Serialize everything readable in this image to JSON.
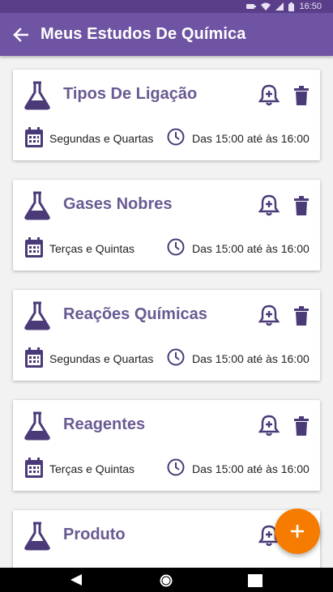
{
  "status_bar": {
    "time": "16:50"
  },
  "app_bar": {
    "title": "Meus Estudos De Química"
  },
  "cards": [
    {
      "title": "Tipos De Ligação",
      "days": "Segundas e Quartas",
      "hours": "Das 15:00 até às 16:00"
    },
    {
      "title": "Gases Nobres",
      "days": "Terças e Quintas",
      "hours": "Das 15:00 até às 16:00"
    },
    {
      "title": "Reações Químicas",
      "days": "Segundas e Quartas",
      "hours": "Das 15:00 até às 16:00"
    },
    {
      "title": "Reagentes",
      "days": "Terças e Quintas",
      "hours": "Das 15:00 até às 16:00"
    },
    {
      "title": "Produto",
      "days": "",
      "hours": ""
    }
  ],
  "colors": {
    "primary": "#6e54a3",
    "status": "#5a3e8a",
    "accent": "#f57c00",
    "icon": "#4a3a78",
    "title_text": "#6a5a93"
  },
  "icons": {
    "back": "arrow-left-icon",
    "flask": "flask-icon",
    "alarm": "alarm-add-icon",
    "trash": "trash-icon",
    "calendar": "calendar-icon",
    "clock": "clock-icon",
    "fab": "plus-icon"
  }
}
